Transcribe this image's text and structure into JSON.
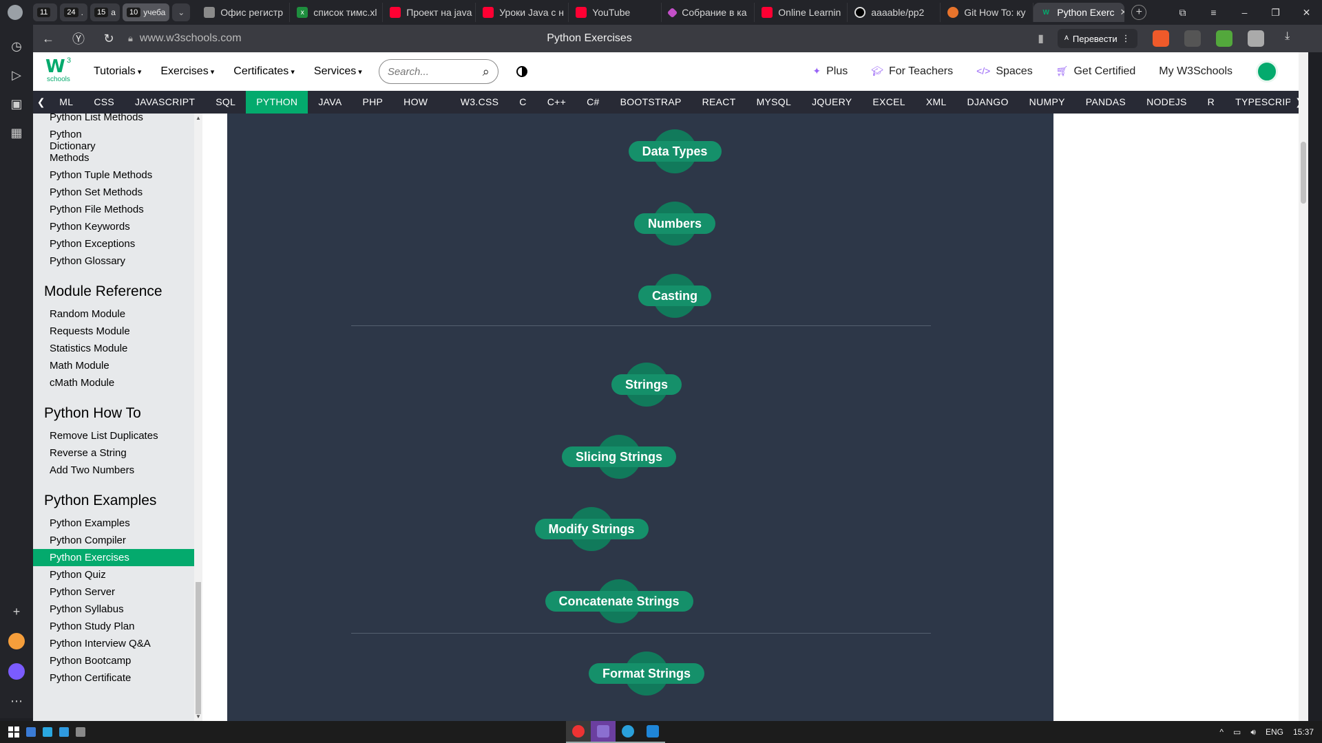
{
  "browser": {
    "pinned": [
      {
        "num": "11",
        "label": ""
      },
      {
        "num": "24",
        "label": "."
      },
      {
        "num": "15",
        "label": "a"
      },
      {
        "num": "10",
        "label": "учеба"
      }
    ],
    "tabs": [
      {
        "label": "Офис регистр",
        "fav": "of"
      },
      {
        "label": "список тимс.xl",
        "fav": "xl"
      },
      {
        "label": "Проект на java",
        "fav": "yt"
      },
      {
        "label": "Уроки Java с н",
        "fav": "yt"
      },
      {
        "label": "YouTube",
        "fav": "yt"
      },
      {
        "label": "Собрание в ка",
        "fav": "pk"
      },
      {
        "label": "Online Learnin",
        "fav": "yt"
      },
      {
        "label": "aaaable/pp2",
        "fav": "gh"
      },
      {
        "label": "Git How To: ку",
        "fav": "gr"
      },
      {
        "label": "Python Exerc",
        "fav": "w3",
        "active": true
      }
    ],
    "url": "www.w3schools.com",
    "page_title": "Python Exercises",
    "translate_label": "Перевести"
  },
  "w3": {
    "logo_sup": "3",
    "logo_sub": "schools",
    "menu": [
      "Tutorials",
      "Exercises",
      "Certificates",
      "Services"
    ],
    "search_placeholder": "Search...",
    "right": [
      "Plus",
      "For Teachers",
      "Spaces",
      "Get Certified",
      "My W3Schools"
    ],
    "tutorials": [
      "ML",
      "CSS",
      "JAVASCRIPT",
      "SQL",
      "PYTHON",
      "JAVA",
      "PHP",
      "HOW TO",
      "W3.CSS",
      "C",
      "C++",
      "C#",
      "BOOTSTRAP",
      "REACT",
      "MYSQL",
      "JQUERY",
      "EXCEL",
      "XML",
      "DJANGO",
      "NUMPY",
      "PANDAS",
      "NODEJS",
      "R",
      "TYPESCRIPT"
    ],
    "active_tutorial": "PYTHON"
  },
  "sidebar": {
    "top_links": [
      "Python List Methods",
      "Python Dictionary Methods",
      "Python Tuple Methods",
      "Python Set Methods",
      "Python File Methods",
      "Python Keywords",
      "Python Exceptions",
      "Python Glossary"
    ],
    "sections": [
      {
        "title": "Module Reference",
        "links": [
          "Random Module",
          "Requests Module",
          "Statistics Module",
          "Math Module",
          "cMath Module"
        ]
      },
      {
        "title": "Python How To",
        "links": [
          "Remove List Duplicates",
          "Reverse a String",
          "Add Two Numbers"
        ]
      },
      {
        "title": "Python Examples",
        "links": [
          "Python Examples",
          "Python Compiler",
          "Python Exercises",
          "Python Quiz",
          "Python Server",
          "Python Syllabus",
          "Python Study Plan",
          "Python Interview Q&A",
          "Python Bootcamp",
          "Python Certificate"
        ]
      }
    ],
    "active_link": "Python Exercises"
  },
  "exercise_nodes": [
    {
      "label": "Data Types"
    },
    {
      "label": "Numbers"
    },
    {
      "label": "Casting"
    },
    {
      "label": "Strings"
    },
    {
      "label": "Slicing Strings"
    },
    {
      "label": "Modify Strings"
    },
    {
      "label": "Concatenate Strings"
    },
    {
      "label": "Format Strings"
    }
  ],
  "taskbar": {
    "lang": "ENG",
    "time": "15:37"
  }
}
